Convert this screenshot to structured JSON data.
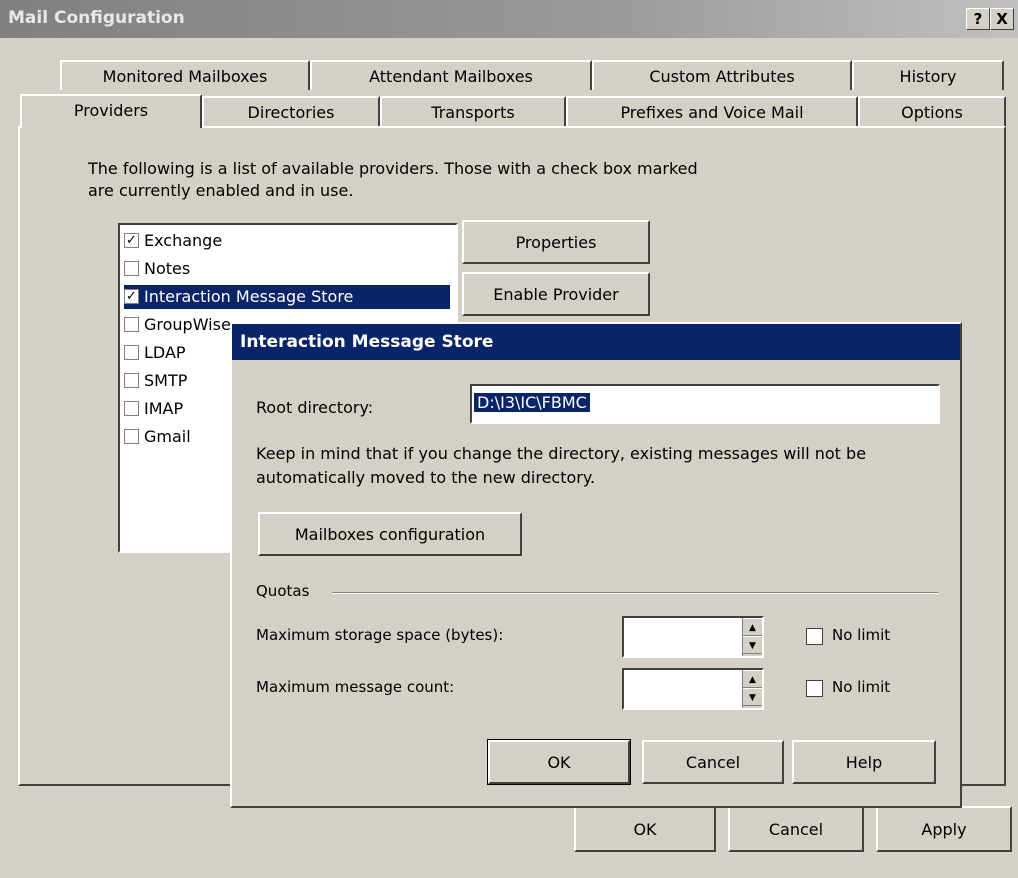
{
  "window": {
    "title": "Mail Configuration",
    "help_button": "?",
    "close_button": "X"
  },
  "tabs": {
    "row1": [
      "Monitored Mailboxes",
      "Attendant Mailboxes",
      "Custom Attributes",
      "History"
    ],
    "row2": [
      "Providers",
      "Directories",
      "Transports",
      "Prefixes and Voice Mail",
      "Options"
    ],
    "selected": "Providers"
  },
  "providers": {
    "description": "The following is a list of available providers. Those with a check box marked are currently enabled and in use.",
    "items": [
      {
        "label": "Exchange",
        "checked": true,
        "selected": false
      },
      {
        "label": "Notes",
        "checked": false,
        "selected": false
      },
      {
        "label": "Interaction Message Store",
        "checked": true,
        "selected": true
      },
      {
        "label": "GroupWise",
        "checked": false,
        "selected": false
      },
      {
        "label": "LDAP",
        "checked": false,
        "selected": false
      },
      {
        "label": "SMTP",
        "checked": false,
        "selected": false
      },
      {
        "label": "IMAP",
        "checked": false,
        "selected": false
      },
      {
        "label": "Gmail",
        "checked": false,
        "selected": false
      }
    ],
    "properties_label": "Properties",
    "enable_label": "Enable Provider"
  },
  "dialog": {
    "title": "Interaction Message Store",
    "root_label": "Root directory:",
    "root_value": "D:\\I3\\IC\\FBMC",
    "note": "Keep in mind that if you change the directory, existing messages will not be automatically moved to the new directory.",
    "mailboxes_button": "Mailboxes configuration",
    "quotas_label": "Quotas",
    "storage_label": "Maximum storage space (bytes):",
    "count_label": "Maximum message count:",
    "no_limit_label": "No limit",
    "ok_label": "OK",
    "cancel_label": "Cancel",
    "help_label": "Help"
  },
  "footer": {
    "ok_label": "OK",
    "cancel_label": "Cancel",
    "apply_label": "Apply"
  }
}
